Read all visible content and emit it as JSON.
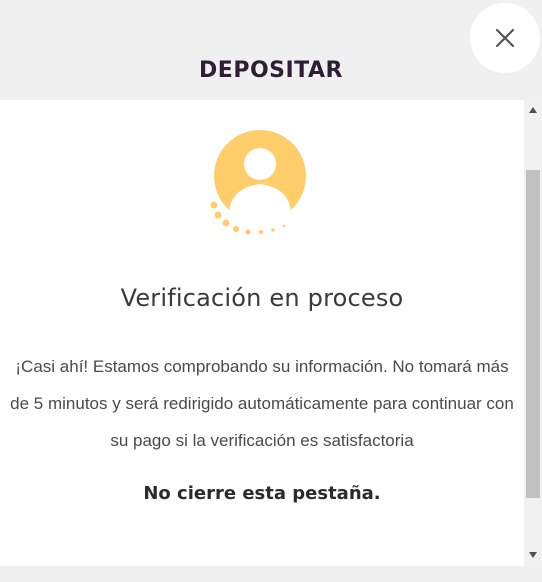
{
  "modal": {
    "title": "DEPOSITAR",
    "close_icon": "close-icon"
  },
  "verification": {
    "avatar_icon": "user-avatar-icon",
    "accent_color": "#ffcd6a",
    "heading": "Verificación en proceso",
    "message": "¡Casi ahí! Estamos comprobando su información. No tomará más de 5 minutos y será redirigido automáticamente para continuar con su pago si la verificación es satisfactoria",
    "warning": "No cierre esta pestaña."
  },
  "scrollbar": {
    "up_icon": "scroll-up-icon",
    "down_icon": "scroll-down-icon"
  }
}
